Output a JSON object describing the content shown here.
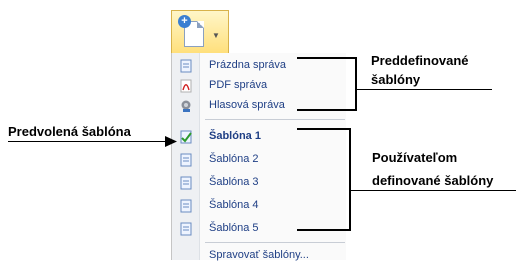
{
  "menu": {
    "predefined": [
      {
        "label": "Prázdna správa",
        "icon": "document-icon"
      },
      {
        "label": "PDF správa",
        "icon": "pdf-icon"
      },
      {
        "label": "Hlasová správa",
        "icon": "voice-icon"
      }
    ],
    "user": [
      {
        "label": "Šablóna 1",
        "icon": "default-template-icon",
        "bold": true
      },
      {
        "label": "Šablóna 2",
        "icon": "document-icon"
      },
      {
        "label": "Šablóna 3",
        "icon": "document-icon"
      },
      {
        "label": "Šablóna 4",
        "icon": "document-icon"
      },
      {
        "label": "Šablóna 5",
        "icon": "document-icon"
      }
    ],
    "manage": "Spravovať šablóny..."
  },
  "annotations": {
    "predefined_line1": "Preddefinované",
    "predefined_line2": "šablóny",
    "default": "Predvolená šablóna",
    "user_line1": "Používateľom",
    "user_line2": "definované šablóny"
  },
  "colors": {
    "menu_text": "#1f3f85"
  }
}
